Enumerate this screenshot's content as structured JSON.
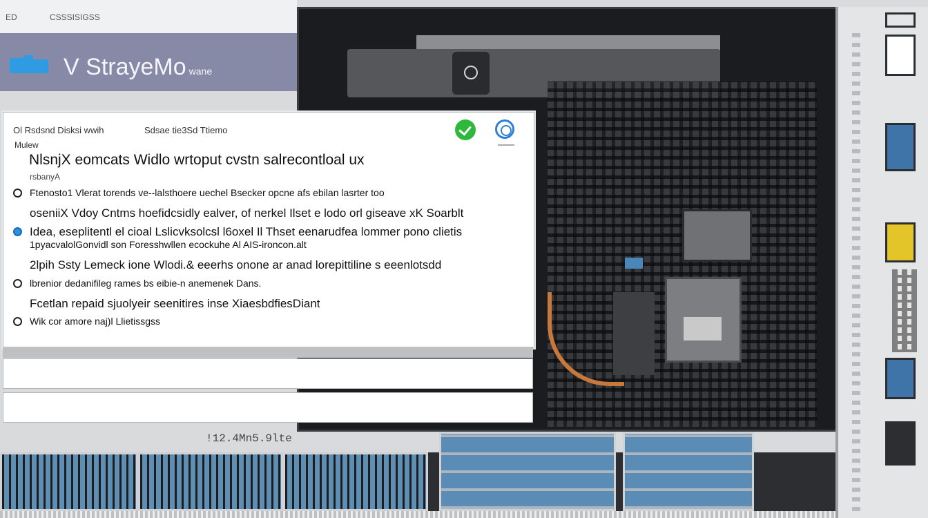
{
  "menubar": {
    "left_label": "ED",
    "right_label": "CSSSISIGSS"
  },
  "brand": {
    "prefix": "V",
    "name": "StrayeMo",
    "suffix": "wane"
  },
  "dialog": {
    "sub_left": "Ol Rsdsnd Disksi wwih",
    "sub_right": "Sdsae tie3Sd Ttiemo",
    "small_label": "Mulew",
    "title": "NlsnjX eomcats Widlo wrtoput cvstn salrecontloal ux",
    "tiny_label": "rsbanyA",
    "lines": [
      "Ftenosto1 Vlerat torends ve--lalsthoere uechel Bsecker opcne afs ebilan lasrter too",
      "oseniiX Vdoy Cntms hoefidcsidly ealver,  of nerkel Ilset e lodo orl giseave xK Soarblt",
      "Idea, eseplitentl el cioal Lslicvksolcsl l6oxel Il Thset eenarudfea lommer pono clietis",
      "1pyacvalolGonvidl son Foresshwllen ecockuhe Al AIS-ironcon.alt",
      "2lpih Ssty  Lemeck ione Wlodi.&  eeerhs onone ar anad lorepittiline s eeenlotsdd",
      "lbrenior dedanifileg rames bs eibie-n anemenek Dans.",
      "Fcetlan repaid sjuolyeir seenitires inse XiaesbdfiesDiant",
      "Wik cor amore naj)l Llietissgss"
    ]
  },
  "footer_label": "!12.4Mn5.9lte",
  "colors": {
    "brand_bg": "#878aa6",
    "accent_green": "#2eb93c",
    "accent_blue": "#2d7fd6"
  },
  "icons": [
    "folder-icon",
    "ok-check-icon",
    "info-circle-icon"
  ]
}
